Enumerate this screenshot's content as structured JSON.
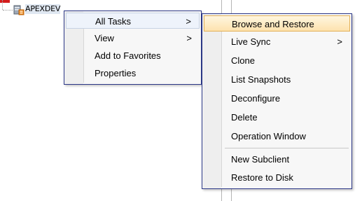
{
  "tree": {
    "node_label": "APEXDEV",
    "node_icon": "server-database-icon"
  },
  "left_menu": {
    "items": [
      {
        "label": "All Tasks",
        "arrow": ">"
      },
      {
        "label": "View",
        "arrow": ">"
      },
      {
        "label": "Add to Favorites"
      },
      {
        "label": "Properties"
      }
    ]
  },
  "right_menu": {
    "items": [
      {
        "label": "Browse and Restore"
      },
      {
        "label": "Live Sync",
        "arrow": ">"
      },
      {
        "label": "Clone"
      },
      {
        "label": "List Snapshots"
      },
      {
        "label": "Deconfigure"
      },
      {
        "label": "Delete"
      },
      {
        "label": "Operation Window"
      },
      {
        "label": "New Subclient"
      },
      {
        "label": "Restore to Disk"
      }
    ]
  },
  "colors": {
    "menu_border": "#2b3787",
    "highlight_top": "#fff6df",
    "highlight_bottom": "#fde2ae",
    "highlight_border": "#e3b157"
  }
}
